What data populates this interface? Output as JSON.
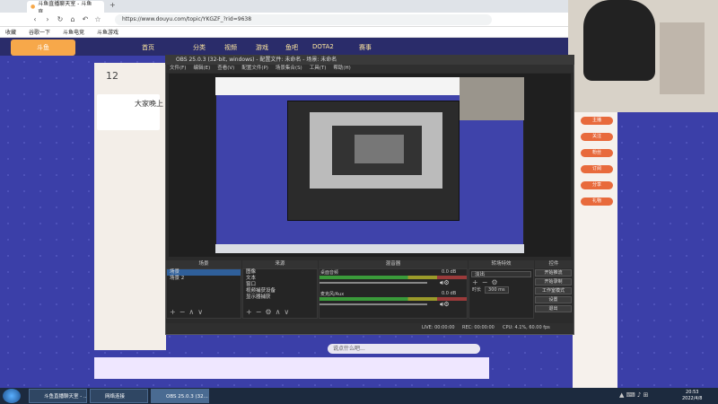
{
  "browser": {
    "tab_active": "斗鱼直播聊天室 - 斗鱼直...",
    "new_tab": "+",
    "url": "https://www.douyu.com/topic/YKGZF_?rid=9638",
    "bookmarks": [
      "收藏",
      "谷歌一下",
      "斗鱼电竞",
      "斗鱼游戏"
    ]
  },
  "site": {
    "logo": "斗鱼",
    "nav": [
      "首页",
      "分类",
      "视频",
      "游戏",
      "鱼吧",
      "DOTA2",
      "赛事"
    ],
    "viewer_count": "12",
    "anchor_title": "大家晚上",
    "pills": [
      "主播",
      "关注",
      "粉丝",
      "订阅",
      "分享",
      "礼物"
    ],
    "chat_placeholder": "说点什么吧..."
  },
  "obs": {
    "title": "OBS 25.0.3 (32-bit, windows) - 配置文件: 未命名 - 场景: 未命名",
    "menu": [
      "文件(F)",
      "编辑(E)",
      "查看(V)",
      "配置文件(P)",
      "场景集合(S)",
      "工具(T)",
      "帮助(H)"
    ],
    "docks": {
      "scenes": {
        "title": "场景",
        "items": [
          "场景",
          "场景 2"
        ]
      },
      "sources": {
        "title": "来源",
        "items": [
          "图像",
          "文本",
          "窗口",
          "视频捕获设备",
          "显示器捕获"
        ]
      },
      "mixer": {
        "title": "混音器",
        "tracks": [
          "桌面音频",
          "麦克风/Aux"
        ],
        "levels": [
          "0.0 dB",
          "0.0 dB"
        ]
      },
      "transitions": {
        "title": "转场特效",
        "type": "淡出",
        "duration_label": "时长",
        "duration": "300 ms"
      },
      "controls": {
        "title": "控件",
        "buttons": [
          "开始推流",
          "开始录制",
          "工作室模式",
          "设置",
          "退出"
        ]
      }
    },
    "status": {
      "live": "LIVE: 00:00:00",
      "rec": "REC: 00:00:00",
      "cpu": "CPU: 4.1%, 60.00 fps"
    }
  },
  "taskbar": {
    "tasks": [
      "斗鱼直播聊天室 - ...",
      "网络连接",
      "OBS 25.0.3 (32..."
    ],
    "time": "20:53",
    "date": "2022/4/8"
  }
}
